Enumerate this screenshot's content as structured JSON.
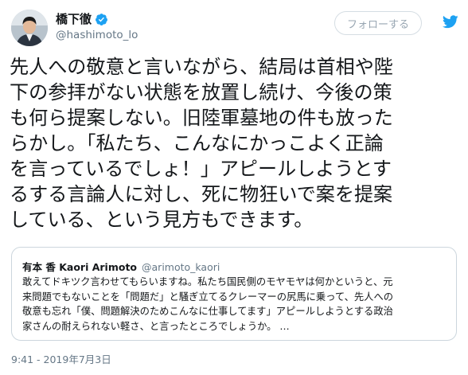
{
  "author": {
    "name": "橋下徹",
    "handle": "@hashimoto_lo",
    "verified": true
  },
  "follow_button": {
    "label": "フォローする"
  },
  "tweet": {
    "text_lines": [
      "先人への敬意と言いながら、結局は首相や陛",
      "下の参拝がない状態を放置し続け、今後の策",
      "も何ら提案しない。旧陸軍墓地の件も放った",
      "らかし。「私たち、こんなにかっこよく正論",
      "を言っているでしょ！」アピールしようとす",
      "るする言論人に対し、死に物狂いで案を提案",
      "している、という見方もできます。"
    ],
    "timestamp": "9:41 - 2019年7月3日"
  },
  "quoted_tweet": {
    "name": "有本 香 Kaori Arimoto",
    "handle": "@arimoto_kaori",
    "text_lines": [
      "敢えてドキツク言わせてもらいますね。私たち国民側のモヤモヤは何かというと、元",
      "来問題でもないことを「問題だ」と騒ぎ立てるクレーマーの尻馬に乗って、先人への",
      "敬意も忘れ「僕、問題解決のためこんなに仕事してます」アピールしようとする政治",
      "家さんの耐えられない軽さ、と言ったところでしょうか。 …"
    ]
  },
  "colors": {
    "text": "#14171a",
    "secondary": "#657786",
    "twitter_blue": "#1da1f2",
    "border": "#ccd6dd"
  },
  "icons": [
    "verified-badge-icon",
    "twitter-bird-icon"
  ]
}
